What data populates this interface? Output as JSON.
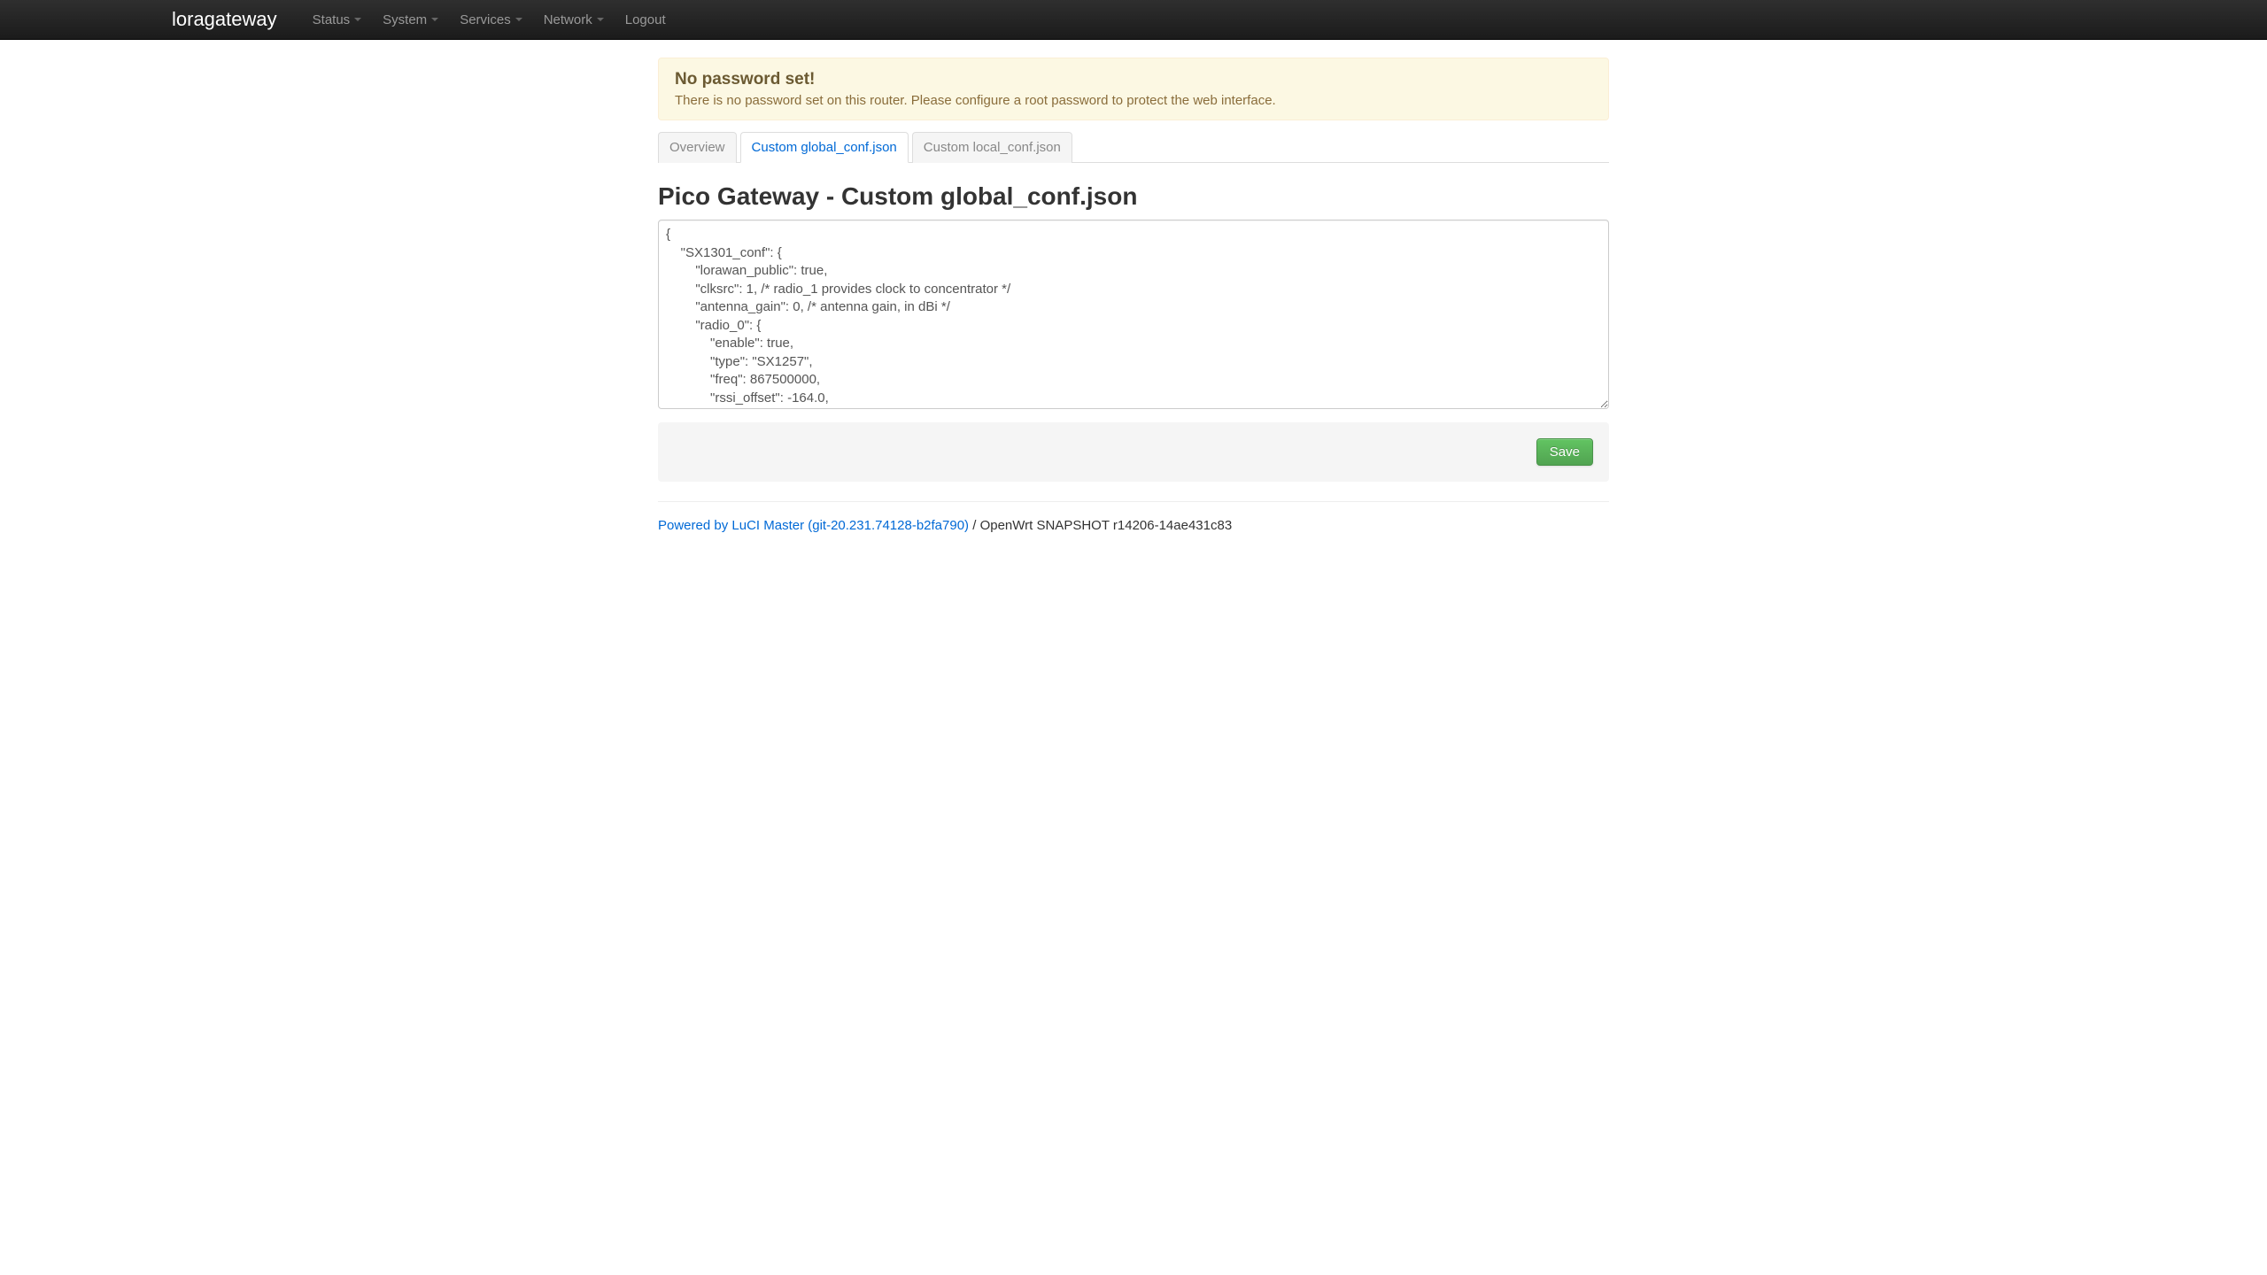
{
  "navbar": {
    "brand": "loragateway",
    "items": [
      {
        "label": "Status",
        "dropdown": true
      },
      {
        "label": "System",
        "dropdown": true
      },
      {
        "label": "Services",
        "dropdown": true
      },
      {
        "label": "Network",
        "dropdown": true
      },
      {
        "label": "Logout",
        "dropdown": false
      }
    ]
  },
  "alert": {
    "title": "No password set!",
    "message": "There is no password set on this router. Please configure a root password to protect the web interface."
  },
  "tabs": [
    {
      "label": "Overview",
      "active": false
    },
    {
      "label": "Custom global_conf.json",
      "active": true
    },
    {
      "label": "Custom local_conf.json",
      "active": false
    }
  ],
  "page_title": "Pico Gateway - Custom global_conf.json",
  "config_content": "{\n    \"SX1301_conf\": {\n        \"lorawan_public\": true,\n        \"clksrc\": 1, /* radio_1 provides clock to concentrator */\n        \"antenna_gain\": 0, /* antenna gain, in dBi */\n        \"radio_0\": {\n            \"enable\": true,\n            \"type\": \"SX1257\",\n            \"freq\": 867500000,\n            \"rssi_offset\": -164.0,",
  "actions": {
    "save_label": "Save"
  },
  "footer": {
    "link_text": "Powered by LuCI Master (git-20.231.74128-b2fa790)",
    "separator": " / ",
    "version_text": "OpenWrt SNAPSHOT r14206-14ae431c83"
  }
}
